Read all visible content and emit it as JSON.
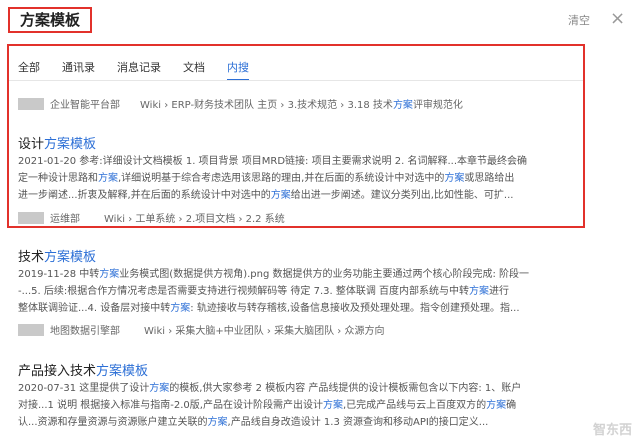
{
  "search": {
    "query": "方案模板",
    "clear_label": "清空",
    "close_glyph": "×"
  },
  "tabs": [
    {
      "label": "全部",
      "active": false
    },
    {
      "label": "通讯录",
      "active": false
    },
    {
      "label": "消息记录",
      "active": false
    },
    {
      "label": "文档",
      "active": false
    },
    {
      "label": "内搜",
      "active": true
    }
  ],
  "top_result": {
    "dept": "企业智能平台部",
    "crumbs": "Wiki › ERP-财务技术团队 主页 › 3.技术规范 › 3.18 技术方案评审规范化"
  },
  "results": [
    {
      "title_a": "设计",
      "title_hl": "方案模板",
      "line1": "2021-01-20 参考:详细设计文档模板 1. 项目背景 项目MRD链接: 项目主要需求说明 2. 名词解释...本章节最终会确",
      "line2": "定一种设计思路和方案,详细说明基于综合考虑选用该思路的理由,并在后面的系统设计中对选中的方案或思路给出",
      "line3": "进一步阐述...折衷及解释,并在后面的系统设计中对选中的方案给出进一步阐述。建议分类列出,比如性能、可扩...",
      "dept": "运维部",
      "crumbs": "Wiki › 工单系统 › 2.项目文档 › 2.2 系统"
    },
    {
      "title_a": "技术",
      "title_hl": "方案模板",
      "line1": "2019-11-28 中转方案业务模式图(数据提供方视角).png 数据提供方的业务功能主要通过两个核心阶段完成: 阶段一",
      "line2": "-...5. 后续:根据合作方情况考虑是否需要支持进行视频解码等 待定 7.3. 整体联调 百度内部系统与中转方案进行",
      "line3": "整体联调验证...4. 设备层对接中转方案: 轨迹接收与转存稽核,设备信息接收及预处理处理。指令创建预处理。指...",
      "dept": "地图数据引擎部",
      "crumbs": "Wiki › 采集大脑+中业团队 › 采集大脑团队 › 众源方向"
    },
    {
      "title_a": "产品接入技术",
      "title_hl": "方案模板",
      "line1": "2020-07-31 这里提供了设计方案的模板,供大家参考 2 模板内容 产品线提供的设计模板需包含以下内容: 1、账户",
      "line2": "对接...1 说明 根据接入标准与指南-2.0版,产品在设计阶段需产出设计方案,已完成产品线与云上百度双方的方案确",
      "line3": "认...资源和存量资源与资源账户建立关联的方案,产品线自身改造设计 1.3 资源查询和移动API的接口定义..."
    }
  ],
  "watermark": "智东西"
}
